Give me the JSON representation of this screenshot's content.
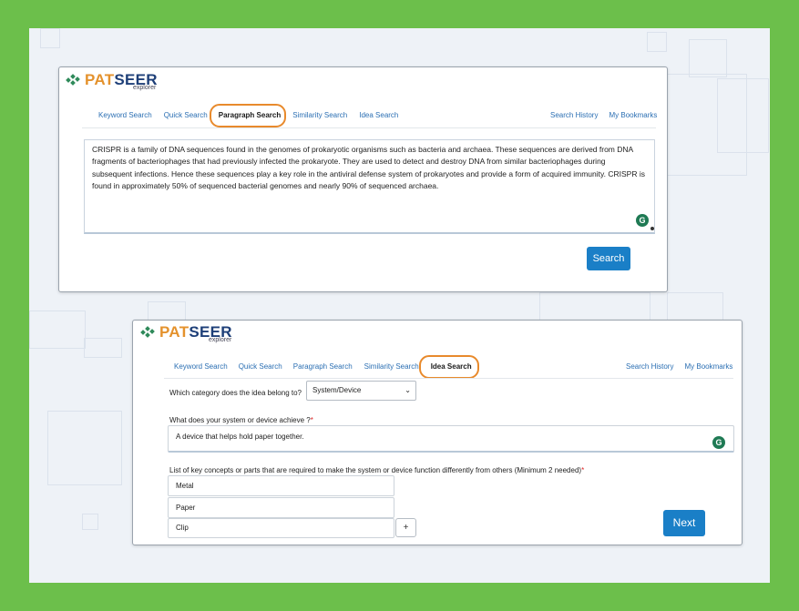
{
  "brand": {
    "pat": "PAT",
    "seer": "SEER",
    "sub": "explorer"
  },
  "panel_top": {
    "tabs": [
      "Keyword Search",
      "Quick Search",
      "Paragraph Search",
      "Similarity Search",
      "Idea Search"
    ],
    "active_tab": "Paragraph Search",
    "right_links": [
      "Search History",
      "My Bookmarks"
    ],
    "paragraph": "CRISPR is a family of DNA sequences found in the genomes of prokaryotic organisms such as bacteria and archaea. These sequences are derived from DNA fragments of bacteriophages that had previously infected the prokaryote. They are used to detect and destroy DNA from similar bacteriophages during subsequent infections. Hence these sequences play a key role in the antiviral defense system of prokaryotes and provide a form of acquired immunity. CRISPR is found in approximately 50% of sequenced bacterial genomes and nearly 90% of sequenced archaea.",
    "search_label": "Search"
  },
  "panel_bottom": {
    "tabs": [
      "Keyword Search",
      "Quick Search",
      "Paragraph Search",
      "Similarity Search",
      "Idea Search"
    ],
    "active_tab": "Idea Search",
    "right_links": [
      "Search History",
      "My Bookmarks"
    ],
    "category_question": "Which category does the idea belong to?",
    "category_value": "System/Device",
    "achieve_question": "What does your system or device achieve ?",
    "achieve_value": "A device that helps hold paper together.",
    "concepts_question": "List of key concepts or parts that are required to make the system or device function differently from others (Minimum 2 needed)",
    "concepts": [
      "Metal",
      "Paper",
      "Clip"
    ],
    "add_label": "+",
    "next_label": "Next"
  },
  "required_mark": "*",
  "grammarly_letter": "G",
  "colors": {
    "frame": "#6cbf4b",
    "accent": "#1a7fc7",
    "highlight": "#e88a2c",
    "link": "#2b6fb3"
  }
}
